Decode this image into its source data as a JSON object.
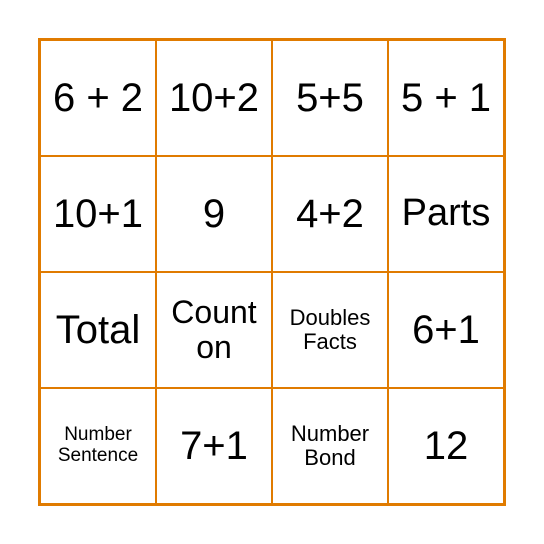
{
  "board": {
    "border_color": "#E07B00",
    "cells": [
      [
        "6 + 2",
        "10+2",
        "5+5",
        "5 + 1"
      ],
      [
        "10+1",
        "9",
        "4+2",
        "Parts"
      ],
      [
        "Total",
        "Count on",
        "Doubles Facts",
        "6+1"
      ],
      [
        "Number Sentence",
        "7+1",
        "Number Bond",
        "12"
      ]
    ]
  }
}
